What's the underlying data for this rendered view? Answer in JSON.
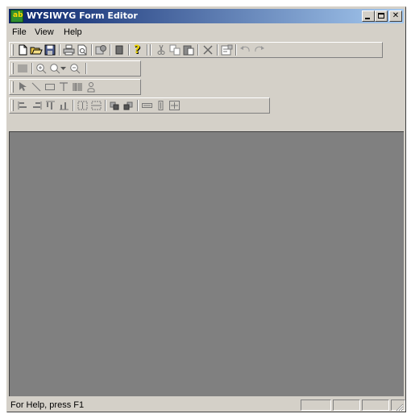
{
  "window": {
    "title": "WYSIWYG Form Editor",
    "app_icon_text": "ab"
  },
  "menu": {
    "items": [
      "File",
      "View",
      "Help"
    ]
  },
  "toolbars": {
    "standard": [
      "new",
      "open",
      "save",
      "print",
      "print-preview",
      "publish",
      "form",
      "help",
      "cut",
      "copy",
      "paste",
      "delete",
      "properties",
      "undo",
      "redo"
    ],
    "zoom": [
      "grid",
      "zoom-in",
      "zoom-dropdown",
      "zoom-out"
    ],
    "drawing": [
      "pointer",
      "line",
      "rectangle",
      "text",
      "barcode",
      "image"
    ],
    "layout": [
      "align-left",
      "align-right",
      "align-top",
      "align-bottom",
      "center-horizontal",
      "center-vertical",
      "bring-to-front",
      "send-to-back",
      "same-width",
      "same-height",
      "same-size"
    ]
  },
  "statusbar": {
    "text": "For Help, press F1"
  }
}
